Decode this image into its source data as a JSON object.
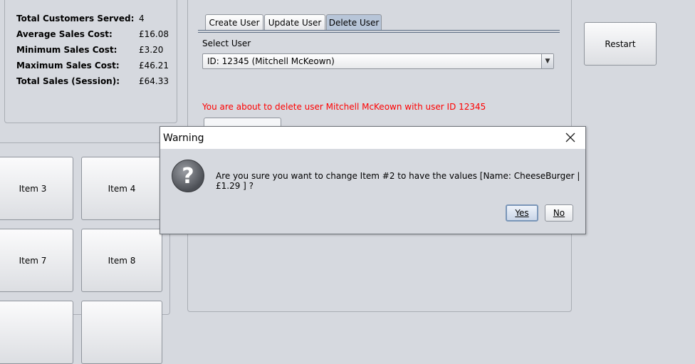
{
  "stats": {
    "rows": [
      {
        "label": "Total Customers Served:",
        "value": "4"
      },
      {
        "label": "Average Sales Cost:",
        "value": "£16.08"
      },
      {
        "label": "Minimum Sales Cost:",
        "value": "£3.20"
      },
      {
        "label": "Maximum Sales Cost:",
        "value": "£46.21"
      },
      {
        "label": "Total Sales (Session):",
        "value": "£64.33"
      }
    ]
  },
  "items": [
    "Item 3",
    "Item 4",
    "Item 7",
    "Item 8"
  ],
  "restart_label": "Restart",
  "tabs": [
    {
      "label": "Create User",
      "active": false
    },
    {
      "label": "Update User",
      "active": false
    },
    {
      "label": "Delete User",
      "active": true
    }
  ],
  "user_panel": {
    "select_label": "Select User",
    "selected_user": "ID: 12345 (Mitchell McKeown)",
    "warning_text": "You are about to delete user Mitchell McKeown with user ID 12345",
    "warning_color": "#ff0000"
  },
  "dialog": {
    "title": "Warning",
    "icon": "question-icon",
    "message": "Are you sure you want to change Item #2 to have the values [Name: CheeseBurger | £1.29 ] ?",
    "yes_label": "Yes",
    "no_label": "No"
  }
}
